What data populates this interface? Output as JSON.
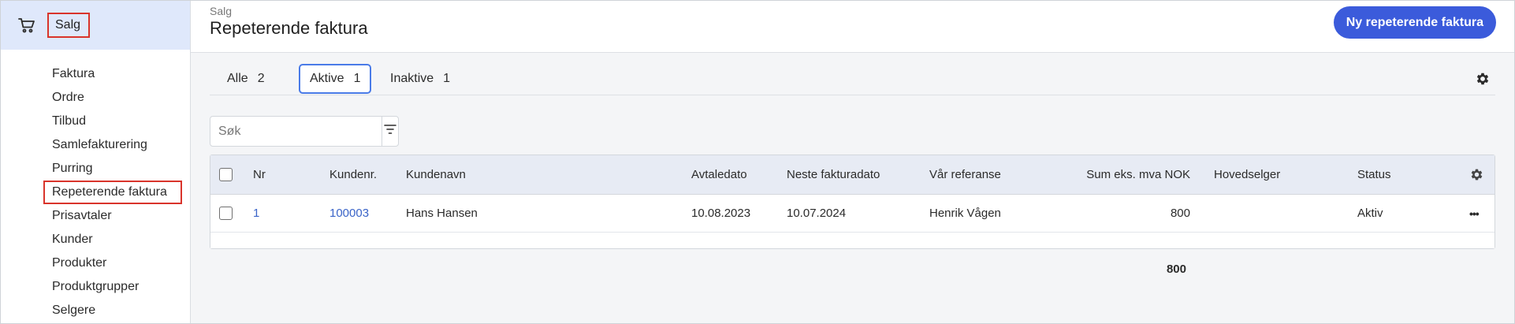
{
  "sidebar": {
    "section_label": "Salg",
    "section_icon": "shopping-cart-icon",
    "items": [
      {
        "label": "Faktura"
      },
      {
        "label": "Ordre"
      },
      {
        "label": "Tilbud"
      },
      {
        "label": "Samlefakturering"
      },
      {
        "label": "Purring"
      },
      {
        "label": "Repeterende faktura",
        "active": true
      },
      {
        "label": "Prisavtaler"
      },
      {
        "label": "Kunder"
      },
      {
        "label": "Produkter"
      },
      {
        "label": "Produktgrupper"
      },
      {
        "label": "Selgere"
      }
    ]
  },
  "header": {
    "breadcrumb": "Salg",
    "title": "Repeterende faktura",
    "primary_button": "Ny repeterende faktura"
  },
  "tabs": [
    {
      "label": "Alle",
      "count": "2",
      "active": false
    },
    {
      "label": "Aktive",
      "count": "1",
      "active": true
    },
    {
      "label": "Inaktive",
      "count": "1",
      "active": false
    }
  ],
  "search": {
    "placeholder": "Søk"
  },
  "table": {
    "columns": {
      "nr": "Nr",
      "kundenr": "Kundenr.",
      "kundenavn": "Kundenavn",
      "avtaledato": "Avtaledato",
      "neste": "Neste fakturadato",
      "referanse": "Vår referanse",
      "sum": "Sum eks. mva NOK",
      "selger": "Hovedselger",
      "status": "Status"
    },
    "rows": [
      {
        "nr": "1",
        "kundenr": "100003",
        "kundenavn": "Hans Hansen",
        "avtaledato": "10.08.2023",
        "neste": "10.07.2024",
        "referanse": "Henrik Vågen",
        "sum": "800",
        "selger": "",
        "status": "Aktiv",
        "menu": "•••"
      }
    ],
    "total": "800"
  },
  "colors": {
    "accent": "#3b5bdb",
    "link": "#3a64c8",
    "highlight": "#d9342b",
    "sidebar_header_bg": "#dfe8fb"
  }
}
